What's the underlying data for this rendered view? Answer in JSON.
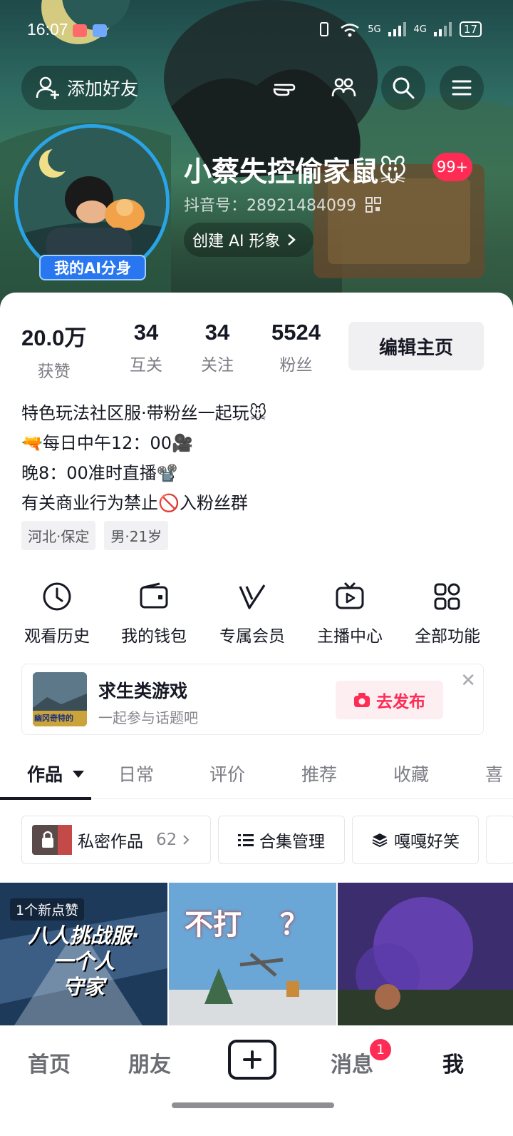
{
  "status_bar": {
    "time": "16:07",
    "network": "5G",
    "network2": "4G",
    "battery": "17"
  },
  "header": {
    "add_friend_label": "添加好友",
    "nickname": "小蔡失控偷家鼠🐭",
    "badge": "99+",
    "douyin_id": "抖音号：28921484099",
    "create_ai_label": "创建 AI 形象",
    "ai_badge": "我的AI分身"
  },
  "stats": [
    {
      "value": "20.0万",
      "label": "获赞"
    },
    {
      "value": "34",
      "label": "互关"
    },
    {
      "value": "34",
      "label": "关注"
    },
    {
      "value": "5524",
      "label": "粉丝"
    }
  ],
  "edit_label": "编辑主页",
  "bio": [
    "特色玩法社区服·带粉丝一起玩🐭",
    "🔫每日中午12：00🎥",
    "晚8：00准时直播📽️",
    "有关商业行为禁止🚫入粉丝群"
  ],
  "tags": [
    "河北·保定",
    "男·21岁"
  ],
  "functions": [
    {
      "label": "观看历史",
      "icon": "clock-icon"
    },
    {
      "label": "我的钱包",
      "icon": "wallet-icon"
    },
    {
      "label": "专属会员",
      "icon": "vip-v-icon"
    },
    {
      "label": "主播中心",
      "icon": "tv-play-icon"
    },
    {
      "label": "全部功能",
      "icon": "grid-apps-icon"
    }
  ],
  "topic": {
    "title": "求生类游戏",
    "subtitle": "一起参与话题吧",
    "thumb_text": "幽冈奇特的",
    "publish_label": "去发布"
  },
  "tabs": [
    "作品",
    "日常",
    "评价",
    "推荐",
    "收藏",
    "喜"
  ],
  "chips": {
    "private_label": "私密作品",
    "private_count": "62",
    "collection_label": "合集管理",
    "album_label": "嘎嘎好笑"
  },
  "videos": [
    {
      "overlay": "1个新点赞",
      "caption1": "八人挑战服·",
      "caption2": "一个人",
      "caption3": "守家"
    },
    {
      "caption1": "不打",
      "caption2": "？"
    },
    {
      "caption1": ""
    }
  ],
  "bottom_nav": {
    "home": "首页",
    "friends": "朋友",
    "messages": "消息",
    "me": "我",
    "msg_badge": "1"
  },
  "colors": {
    "accent": "#fe2c55",
    "blue": "#2877f0"
  }
}
